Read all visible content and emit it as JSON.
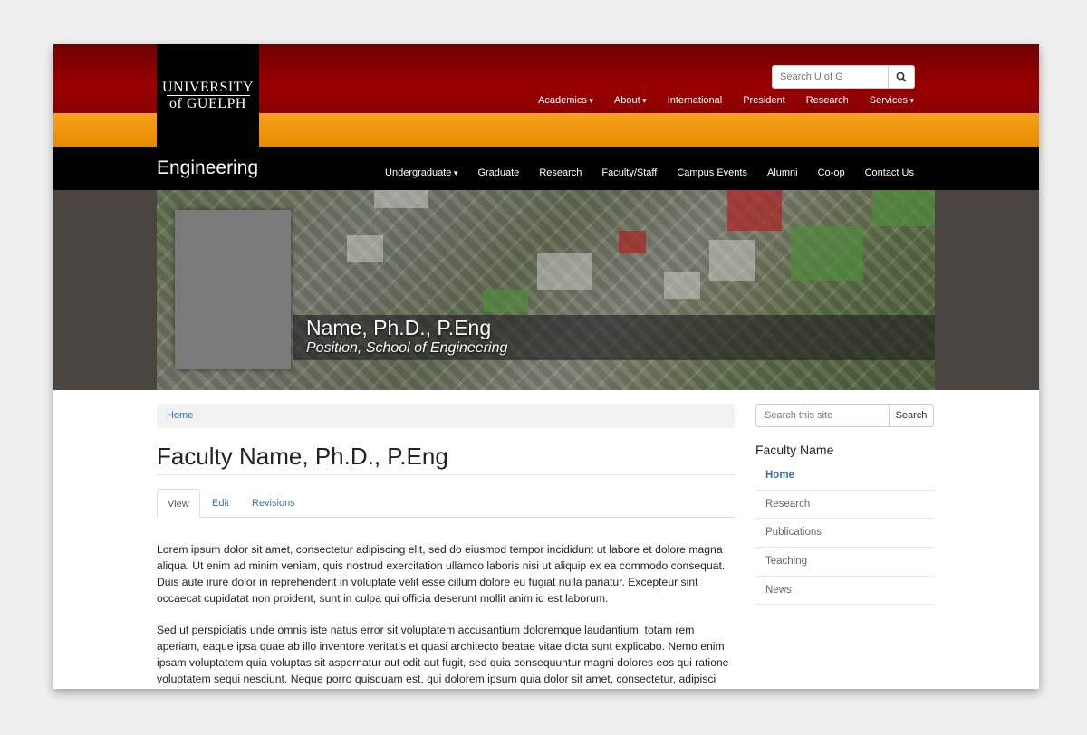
{
  "university": {
    "logo_line1": "UNIVERSITY",
    "logo_line2": "of GUELPH",
    "search_placeholder": "Search U of G",
    "nav": [
      {
        "label": "Academics",
        "dropdown": true
      },
      {
        "label": "About",
        "dropdown": true
      },
      {
        "label": "International",
        "dropdown": false
      },
      {
        "label": "President",
        "dropdown": false
      },
      {
        "label": "Research",
        "dropdown": false
      },
      {
        "label": "Services",
        "dropdown": true
      }
    ]
  },
  "site": {
    "title": "Engineering",
    "nav": [
      {
        "label": "Undergraduate",
        "dropdown": true
      },
      {
        "label": "Graduate",
        "dropdown": false
      },
      {
        "label": "Research",
        "dropdown": false
      },
      {
        "label": "Faculty/Staff",
        "dropdown": false
      },
      {
        "label": "Campus Events",
        "dropdown": false
      },
      {
        "label": "Alumni",
        "dropdown": false
      },
      {
        "label": "Co-op",
        "dropdown": false
      },
      {
        "label": "Contact Us",
        "dropdown": false
      }
    ]
  },
  "hero": {
    "name": "Name, Ph.D., P.Eng",
    "position": "Position, School of Engineering"
  },
  "main": {
    "breadcrumb": "Home",
    "title": "Faculty Name, Ph.D., P.Eng",
    "tabs": [
      {
        "label": "View",
        "active": true
      },
      {
        "label": "Edit",
        "active": false
      },
      {
        "label": "Revisions",
        "active": false
      }
    ],
    "paragraphs": [
      "Lorem ipsum dolor sit amet, consectetur adipiscing elit, sed do eiusmod tempor incididunt ut labore et dolore magna aliqua. Ut enim ad minim veniam, quis nostrud exercitation ullamco laboris nisi ut aliquip ex ea commodo consequat. Duis aute irure dolor in reprehenderit in voluptate velit esse cillum dolore eu fugiat nulla pariatur. Excepteur sint occaecat cupidatat non proident, sunt in culpa qui officia deserunt mollit anim id est laborum.",
      "Sed ut perspiciatis unde omnis iste natus error sit voluptatem accusantium doloremque laudantium, totam rem aperiam, eaque ipsa quae ab illo inventore veritatis et quasi architecto beatae vitae dicta sunt explicabo. Nemo enim ipsam voluptatem quia voluptas sit aspernatur aut odit aut fugit, sed quia consequuntur magni dolores eos qui ratione voluptatem sequi nesciunt. Neque porro quisquam est, qui dolorem ipsum quia dolor sit amet, consectetur, adipisci"
    ]
  },
  "sidebar": {
    "search_placeholder": "Search this site",
    "search_button": "Search",
    "title": "Faculty Name",
    "menu": [
      {
        "label": "Home",
        "active": true
      },
      {
        "label": "Research",
        "active": false
      },
      {
        "label": "Publications",
        "active": false
      },
      {
        "label": "Teaching",
        "active": false
      },
      {
        "label": "News",
        "active": false
      }
    ]
  },
  "colors": {
    "top_red": "#8a0000",
    "orange": "#f7a21a",
    "black": "#000000",
    "link_blue": "#3a6fb0"
  }
}
